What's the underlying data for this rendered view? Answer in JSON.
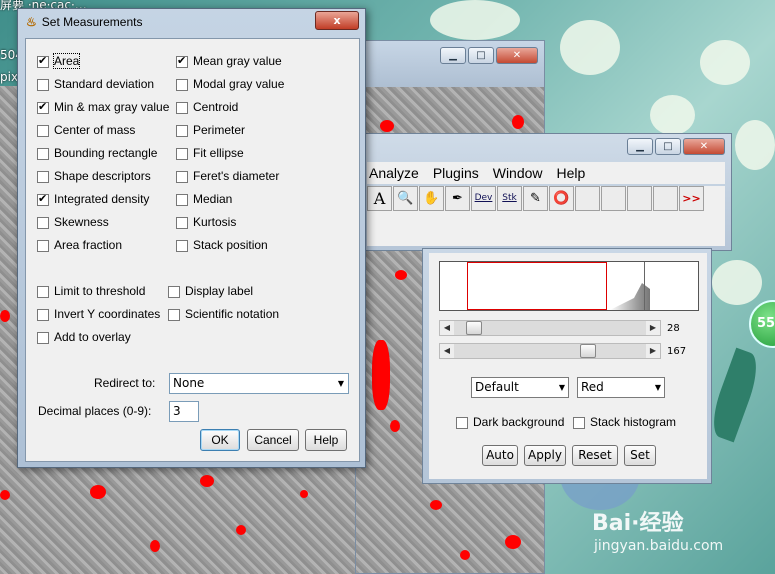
{
  "desktop": {
    "top_text_1": "屏要  ·ne·cac·…",
    "top_text_2": "504",
    "top_text_3": "pix",
    "badge": "55°",
    "watermark": "Bai·经验",
    "watermark_url": "jingyan.baidu.com"
  },
  "imagej_main": {
    "menus": [
      "Analyze",
      "Plugins",
      "Window",
      "Help"
    ],
    "tools": [
      "A",
      "🔍",
      "✋",
      "✒",
      "Dev",
      "Stk",
      "✎",
      "⭕",
      "",
      "",
      "",
      "",
      ">>"
    ]
  },
  "threshold": {
    "slider_min_value": "28",
    "slider_max_value": "167",
    "method": "Default",
    "mode": "Red",
    "dark_background": "Dark background",
    "stack_histogram": "Stack histogram",
    "buttons": [
      "Auto",
      "Apply",
      "Reset",
      "Set"
    ]
  },
  "dialog": {
    "title": "Set Measurements",
    "close_label": "x",
    "options_left": [
      {
        "label": "Area",
        "checked": true
      },
      {
        "label": "Standard deviation",
        "checked": false
      },
      {
        "label": "Min & max gray value",
        "checked": true
      },
      {
        "label": "Center of mass",
        "checked": false
      },
      {
        "label": "Bounding rectangle",
        "checked": false
      },
      {
        "label": "Shape descriptors",
        "checked": false
      },
      {
        "label": "Integrated density",
        "checked": true
      },
      {
        "label": "Skewness",
        "checked": false
      },
      {
        "label": "Area fraction",
        "checked": false
      }
    ],
    "options_right": [
      {
        "label": "Mean gray value",
        "checked": true
      },
      {
        "label": "Modal gray value",
        "checked": false
      },
      {
        "label": "Centroid",
        "checked": false
      },
      {
        "label": "Perimeter",
        "checked": false
      },
      {
        "label": "Fit ellipse",
        "checked": false
      },
      {
        "label": "Feret's diameter",
        "checked": false
      },
      {
        "label": "Median",
        "checked": false
      },
      {
        "label": "Kurtosis",
        "checked": false
      },
      {
        "label": "Stack position",
        "checked": false
      }
    ],
    "extra_left": [
      {
        "label": "Limit to threshold",
        "checked": false
      },
      {
        "label": "Invert Y coordinates",
        "checked": false
      },
      {
        "label": "Add to overlay",
        "checked": false
      }
    ],
    "extra_right": [
      {
        "label": "Display label",
        "checked": false
      },
      {
        "label": "Scientific notation",
        "checked": false
      }
    ],
    "redirect_label": "Redirect to:",
    "redirect_value": "None",
    "decimal_label": "Decimal places (0-9):",
    "decimal_value": "3",
    "ok": "OK",
    "cancel": "Cancel",
    "help": "Help"
  }
}
